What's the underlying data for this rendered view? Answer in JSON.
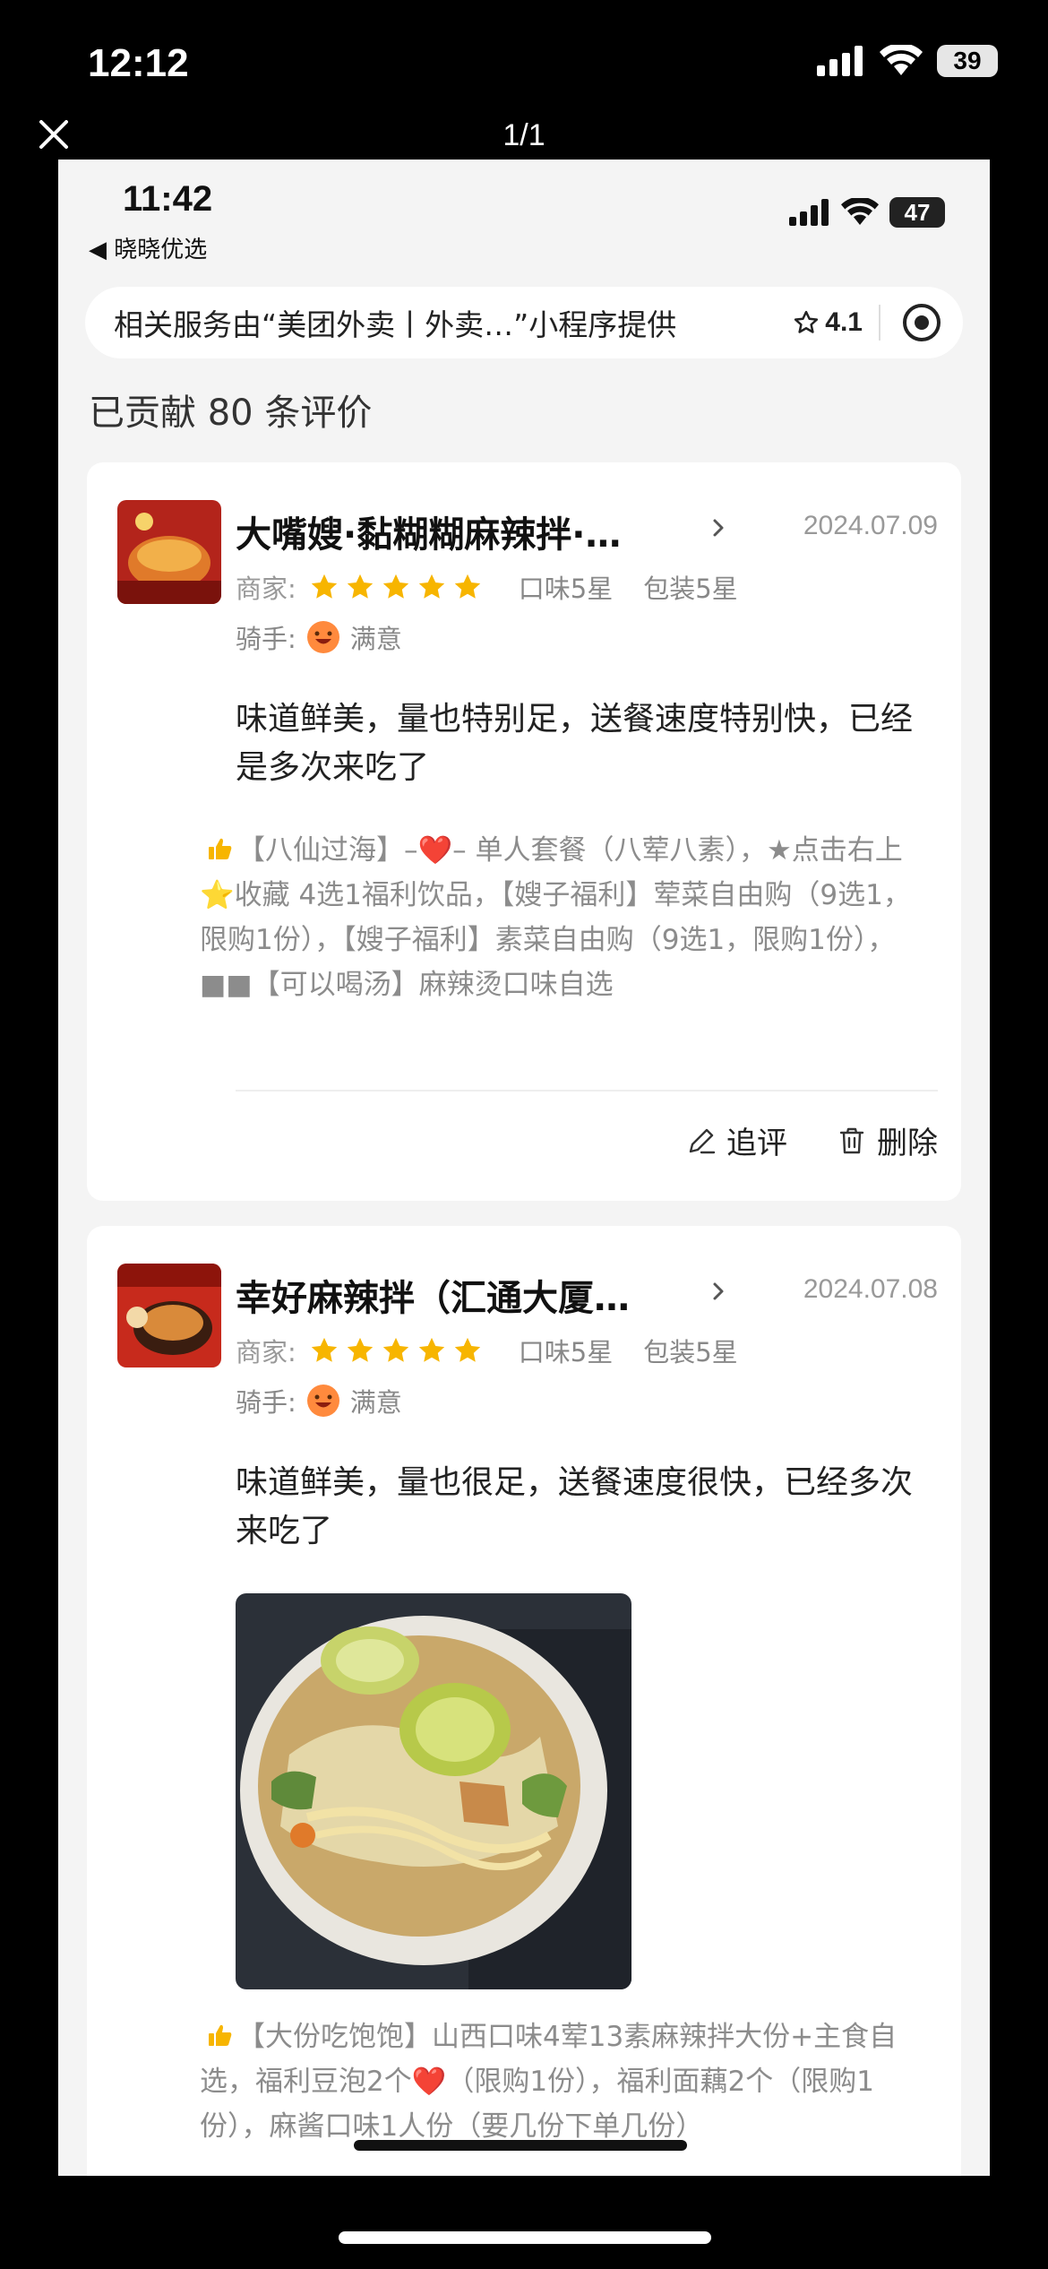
{
  "outer": {
    "time": "12:12",
    "battery": "39",
    "page_counter": "1/1"
  },
  "inner": {
    "time": "11:42",
    "back_label": "◀ 晓晓优选",
    "battery": "47"
  },
  "service_bar": {
    "text": "相关服务由“美团外卖丨外卖…”小程序提供",
    "rating": "4.1"
  },
  "contribution": "已贡献 80 条评价",
  "reviews": [
    {
      "shop": "大嘴嫂·黏糊糊麻辣拌·…",
      "date": "2024.07.09",
      "merchant_label": "商家:",
      "stars": 5,
      "taste": "口味5星",
      "package": "包装5星",
      "rider_label": "骑手:",
      "rider_rating": "满意",
      "text": "味道鲜美，量也特别足，送餐速度特别快，已经是多次来吃了",
      "items": "【八仙过海】–❤️– 单人套餐（八荤八素），★点击右上⭐收藏 4选1福利饮品，【嫂子福利】荤菜自由购（9选1，限购1份），【嫂子福利】素菜自由购（9选1，限购1份），■■【可以喝汤】麻辣烫口味自选",
      "action_followup": "追评",
      "action_delete": "删除"
    },
    {
      "shop": "幸好麻辣拌（汇通大厦…",
      "date": "2024.07.08",
      "merchant_label": "商家:",
      "stars": 5,
      "taste": "口味5星",
      "package": "包装5星",
      "rider_label": "骑手:",
      "rider_rating": "满意",
      "text": "味道鲜美，量也很足，送餐速度很快，已经多次来吃了",
      "items": "【大份吃饱饱】山西口味4荤13素麻辣拌大份+主食自选，福利豆泡2个❤️（限购1份），福利面藕2个（限购1份），麻酱口味1人份（要几份下单几份）"
    }
  ],
  "colors": {
    "star": "#f7b500",
    "muted": "#999999",
    "background": "#f4f4f4"
  }
}
